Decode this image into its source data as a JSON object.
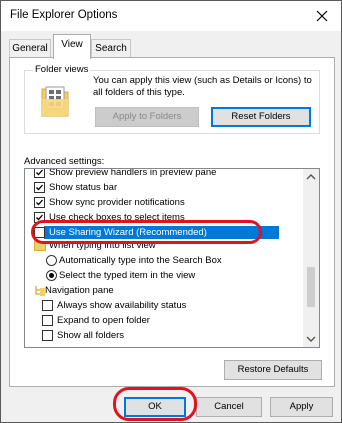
{
  "window": {
    "title": "File Explorer Options",
    "close_glyph": "close-icon"
  },
  "tabs": [
    {
      "label": "General",
      "active": false
    },
    {
      "label": "View",
      "active": true
    },
    {
      "label": "Search",
      "active": false
    }
  ],
  "folder_views": {
    "legend": "Folder views",
    "description": "You can apply this view (such as Details or Icons) to all folders of this type.",
    "apply_button": "Apply to Folders",
    "reset_button": "Reset Folders"
  },
  "advanced": {
    "label": "Advanced settings:",
    "items": [
      {
        "type": "checkbox",
        "checked": true,
        "label": "Show preview handlers in preview pane"
      },
      {
        "type": "checkbox",
        "checked": true,
        "label": "Show status bar"
      },
      {
        "type": "checkbox",
        "checked": true,
        "label": "Show sync provider notifications"
      },
      {
        "type": "checkbox",
        "checked": true,
        "label": "Use check boxes to select items"
      },
      {
        "type": "checkbox",
        "checked": false,
        "label": "Use Sharing Wizard (Recommended)",
        "selected": true
      },
      {
        "type": "folder",
        "label": "When typing into list view"
      },
      {
        "type": "radio",
        "checked": false,
        "label": "Automatically type into the Search Box"
      },
      {
        "type": "radio",
        "checked": true,
        "label": "Select the typed item in the view"
      },
      {
        "type": "folder",
        "label": "Navigation pane"
      },
      {
        "type": "checkbox",
        "checked": false,
        "label": "Always show availability status"
      },
      {
        "type": "checkbox",
        "checked": false,
        "label": "Expand to open folder"
      },
      {
        "type": "checkbox",
        "checked": false,
        "label": "Show all folders"
      }
    ],
    "restore_button": "Restore Defaults"
  },
  "footer": {
    "ok": "OK",
    "cancel": "Cancel",
    "apply": "Apply"
  },
  "colors": {
    "accent": "#0078d7",
    "annotation": "#e0141e"
  }
}
